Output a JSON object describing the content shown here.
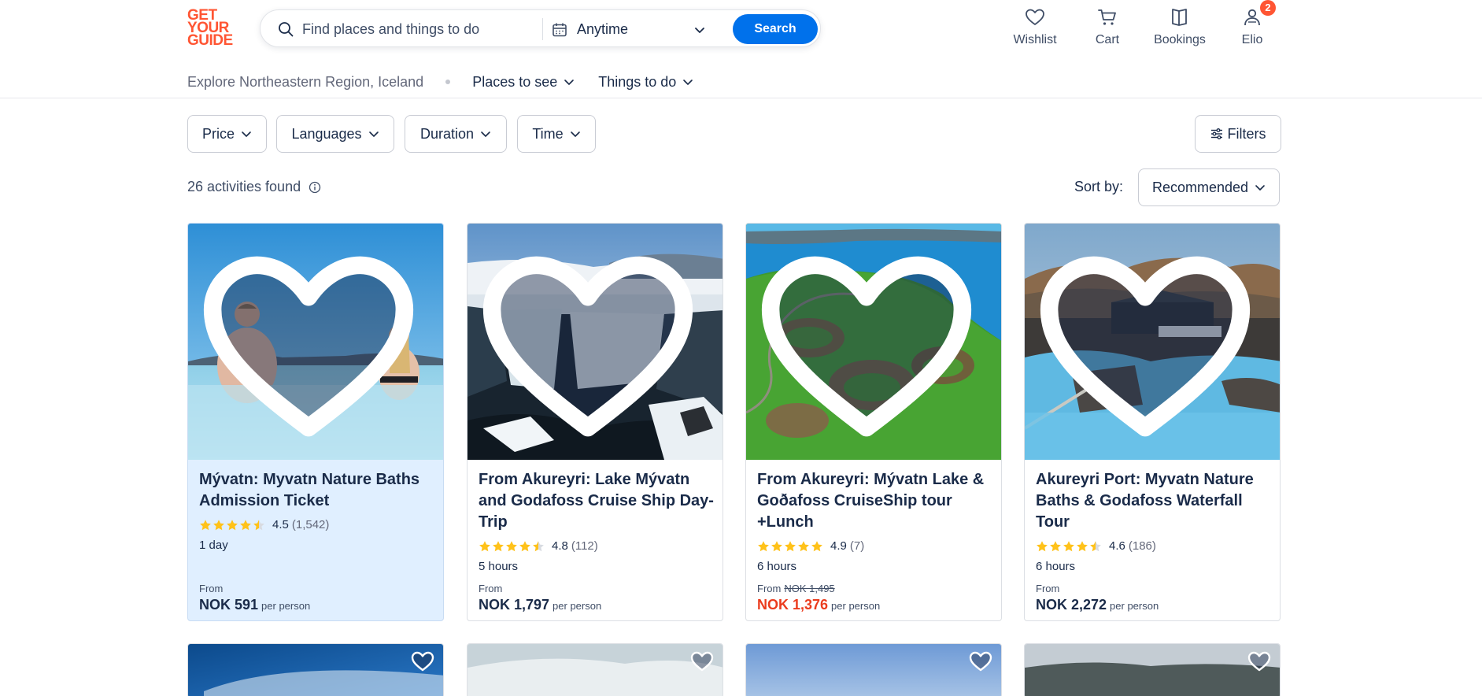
{
  "header": {
    "logo_lines": [
      "GET",
      "YOUR",
      "GUIDE"
    ],
    "search_placeholder": "Find places and things to do",
    "date_label": "Anytime",
    "search_button": "Search",
    "nav": [
      {
        "label": "Wishlist",
        "icon": "heart-icon"
      },
      {
        "label": "Cart",
        "icon": "cart-icon"
      },
      {
        "label": "Bookings",
        "icon": "bookmark-icon"
      },
      {
        "label": "Elio",
        "icon": "profile-icon",
        "badge": "2"
      }
    ]
  },
  "subnav": {
    "explore": "Explore Northeastern Region, Iceland",
    "places": "Places to see",
    "things": "Things to do"
  },
  "filters": {
    "chips": [
      "Price",
      "Languages",
      "Duration",
      "Time"
    ],
    "filters_button": "Filters"
  },
  "results": {
    "count_text": "26 activities found",
    "sort_label": "Sort by:",
    "sort_value": "Recommended"
  },
  "colors": {
    "brand": "#ff5533",
    "primary": "#0071eb",
    "discount": "#eb3c1e",
    "star": "#ffc21a"
  },
  "cards": [
    {
      "title": "Mývatn: Myvatn Nature Baths Admission Ticket",
      "rating": "4.5",
      "reviews": "(1,542)",
      "stars": 4.5,
      "duration": "1 day",
      "price_from": "From",
      "old_price": "",
      "price": "NOK 591",
      "per": "per person"
    },
    {
      "title": "From Akureyri: Lake Mývatn and Godafoss Cruise Ship Day-Trip",
      "rating": "4.8",
      "reviews": "(112)",
      "stars": 4.5,
      "duration": "5 hours",
      "price_from": "From",
      "old_price": "",
      "price": "NOK 1,797",
      "per": "per person"
    },
    {
      "title": "From Akureyri: Mývatn Lake & Goðafoss CruiseShip tour +Lunch",
      "rating": "4.9",
      "reviews": "(7)",
      "stars": 5,
      "duration": "6 hours",
      "price_from": "From",
      "old_price": "NOK 1,495",
      "price": "NOK 1,376",
      "per": "per person"
    },
    {
      "title": "Akureyri Port: Myvatn Nature Baths & Godafoss Waterfall Tour",
      "rating": "4.6",
      "reviews": "(186)",
      "stars": 4.5,
      "duration": "6 hours",
      "price_from": "From",
      "old_price": "",
      "price": "NOK 2,272",
      "per": "per person"
    }
  ]
}
